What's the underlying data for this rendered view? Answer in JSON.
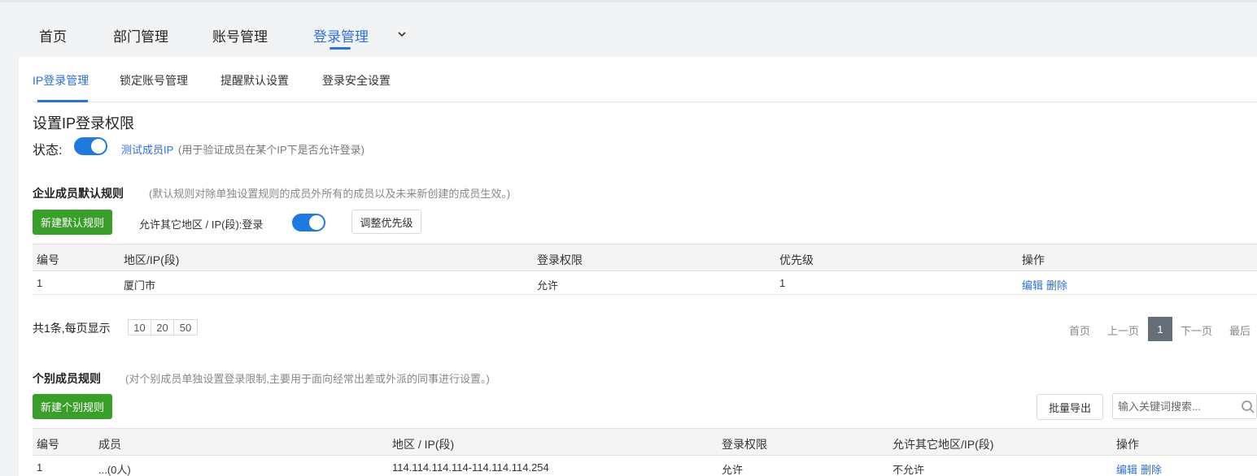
{
  "topnav": {
    "items": [
      "首页",
      "部门管理",
      "账号管理",
      "登录管理"
    ],
    "active_index": 3,
    "more_icon": "chevron-down-icon"
  },
  "subtabs": {
    "items": [
      "IP登录管理",
      "锁定账号管理",
      "提醒默认设置",
      "登录安全设置"
    ],
    "active_index": 0
  },
  "ip_settings": {
    "title": "设置IP登录权限",
    "status_label": "状态:",
    "status_enabled": true,
    "test_link": "测试成员IP",
    "test_note": "(用于验证成员在某个IP下是否允许登录)"
  },
  "default_rules": {
    "title": "企业成员默认规则",
    "note": "(默认规则对除单独设置规则的成员外所有的成员以及未来新创建的成员生效。)",
    "new_button": "新建默认规则",
    "allow_other_label": "允许其它地区 / IP(段):登录",
    "allow_other_enabled": true,
    "priority_button": "调整优先级",
    "columns": [
      "编号",
      "地区/IP(段)",
      "登录权限",
      "优先级",
      "操作"
    ],
    "rows": [
      {
        "id": "1",
        "region": "厦门市",
        "permission": "允许",
        "priority": "1",
        "edit": "编辑",
        "delete": "删除"
      }
    ],
    "pagination": {
      "summary": "共1条,每页显示",
      "sizes": [
        "10",
        "20",
        "50"
      ],
      "first": "首页",
      "prev": "上一页",
      "current": "1",
      "next": "下一页",
      "last": "最后"
    }
  },
  "individual_rules": {
    "title": "个别成员规则",
    "note": "(对个别成员单独设置登录限制,主要用于面向经常出差或外派的同事进行设置。)",
    "new_button": "新建个别规则",
    "export_button": "批量导出",
    "search_placeholder": "输入关键词搜索...",
    "columns": [
      "编号",
      "成员",
      "地区 / IP(段)",
      "登录权限",
      "允许其它地区/IP(段)",
      "操作"
    ],
    "rows": [
      {
        "id": "1",
        "member": "...(0人)",
        "range": "114.114.114.114-114.114.114.254",
        "permission": "允许",
        "allow_other": "不允许",
        "edit": "编辑",
        "delete": "删除"
      }
    ]
  },
  "colors": {
    "accent": "#2f6fde",
    "toggle": "#1f7ae0",
    "green_button": "#3a9e2b",
    "current_page": "#666e78"
  }
}
